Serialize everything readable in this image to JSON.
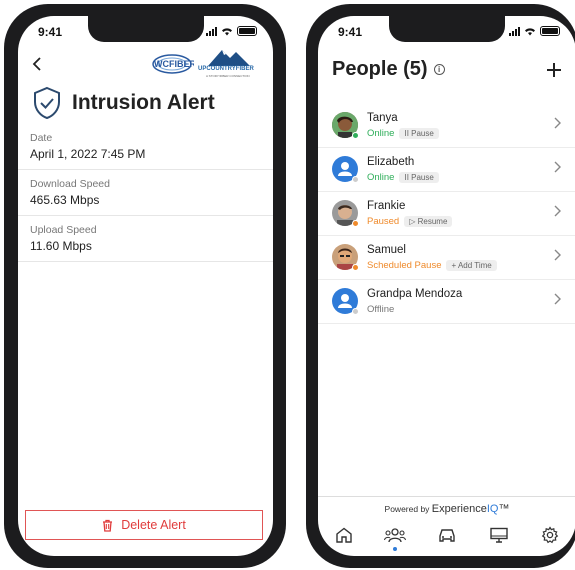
{
  "left_phone": {
    "status_time": "9:41",
    "logo_primary": "WCFIBER",
    "logo_secondary": "UPCOUNTRYFIBER",
    "logo_secondary_tagline": "A STORY/FIBER CONNECTION",
    "title": "Intrusion Alert",
    "fields": [
      {
        "label": "Date",
        "value": "April 1, 2022 7:45 PM"
      },
      {
        "label": "Download Speed",
        "value": "465.63 Mbps"
      },
      {
        "label": "Upload Speed",
        "value": "11.60 Mbps"
      }
    ],
    "delete_label": "Delete Alert",
    "colors": {
      "danger": "#e03c3c"
    }
  },
  "right_phone": {
    "status_time": "9:41",
    "title": "People (5)",
    "people": [
      {
        "name": "Tanya",
        "status": "Online",
        "status_color": "#2fae5a",
        "action": "Pause",
        "action_icon": "pause-icon",
        "dot": "#2fae5a"
      },
      {
        "name": "Elizabeth",
        "status": "Online",
        "status_color": "#2fae5a",
        "action": "Pause",
        "action_icon": "pause-icon",
        "dot": "#cccccc"
      },
      {
        "name": "Frankie",
        "status": "Paused",
        "status_color": "#ef8a2b",
        "action": "Resume",
        "action_icon": "play-icon",
        "dot": "#ef8a2b"
      },
      {
        "name": "Samuel",
        "status": "Scheduled Pause",
        "status_color": "#ef8a2b",
        "action": "Add Time",
        "action_icon": "plus-icon",
        "dot": "#ef8a2b"
      },
      {
        "name": "Grandpa Mendoza",
        "status": "Offline",
        "status_color": "#777777",
        "action": "",
        "action_icon": "",
        "dot": "#cccccc"
      }
    ],
    "powered_by": "Powered by",
    "brand_a": "Experience",
    "brand_b": "IQ",
    "brand_tm": "™",
    "tabs": [
      "home-icon",
      "people-icon",
      "car-icon",
      "monitor-icon",
      "gear-icon"
    ],
    "colors": {
      "accent": "#2f7bd8"
    }
  }
}
